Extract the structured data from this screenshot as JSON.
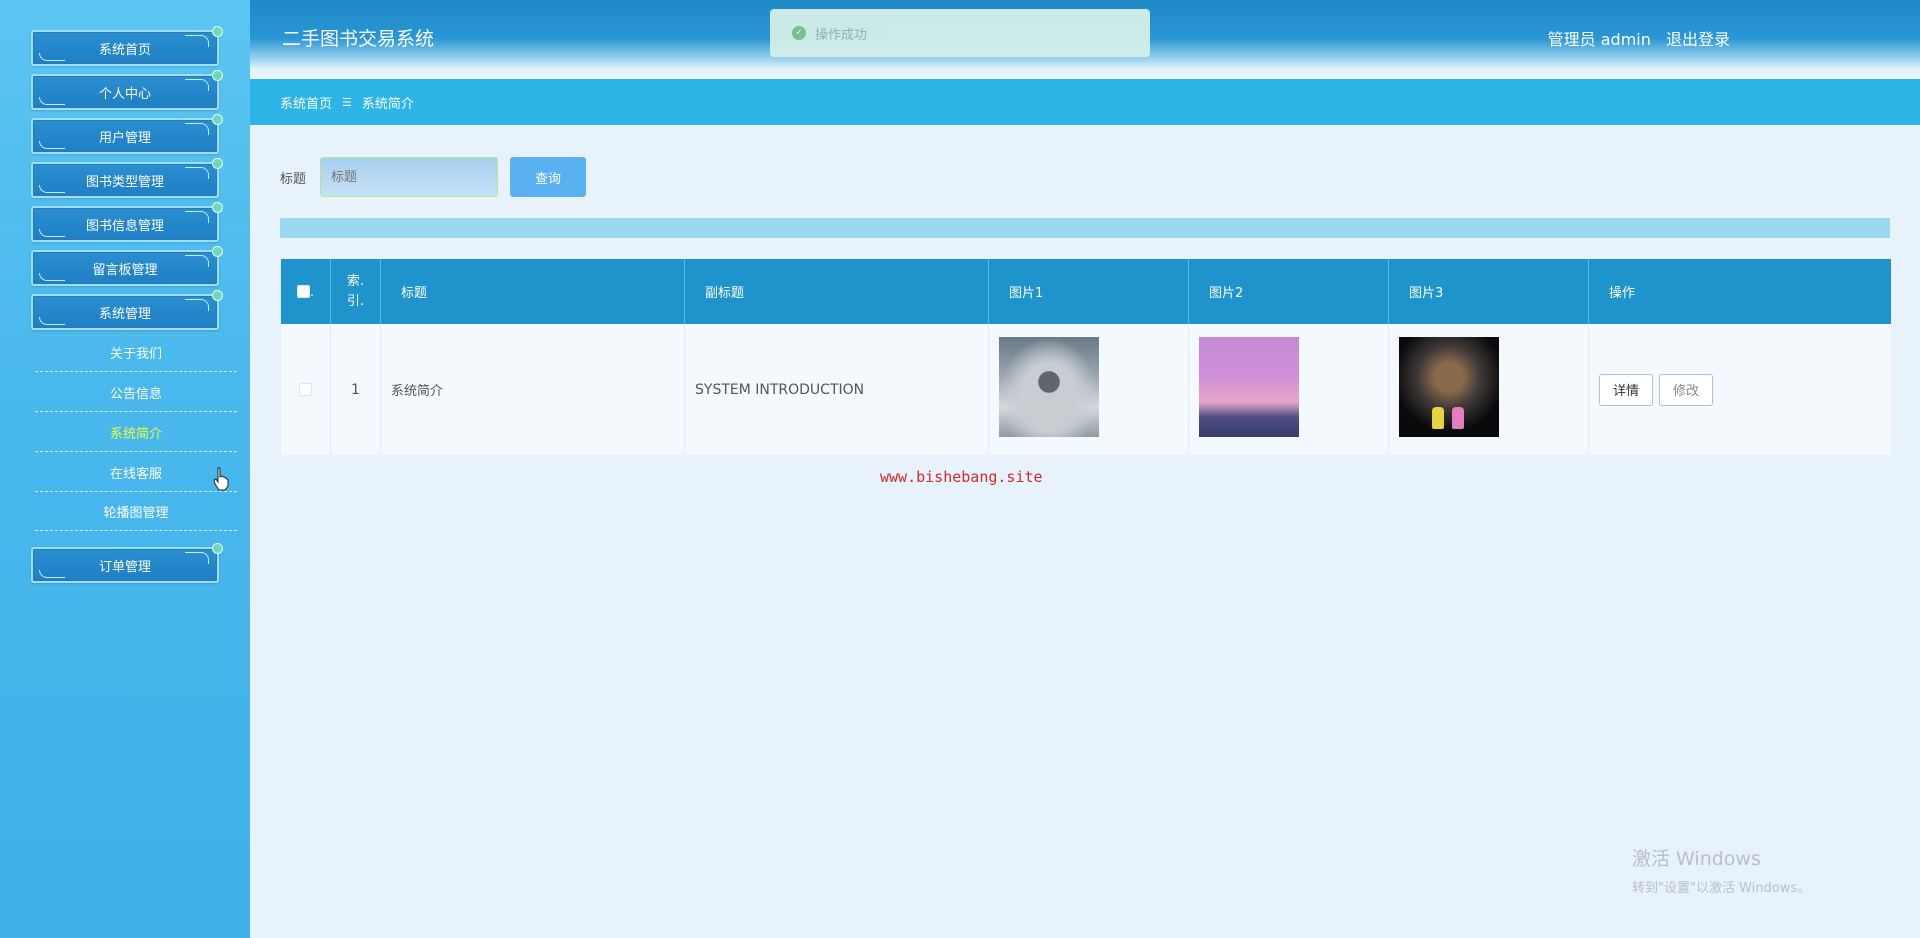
{
  "sidebar": {
    "menu": [
      {
        "label": "系统首页"
      },
      {
        "label": "个人中心"
      },
      {
        "label": "用户管理"
      },
      {
        "label": "图书类型管理"
      },
      {
        "label": "图书信息管理"
      },
      {
        "label": "留言板管理"
      },
      {
        "label": "系统管理"
      }
    ],
    "sub_items": [
      {
        "label": "关于我们"
      },
      {
        "label": "公告信息"
      },
      {
        "label": "系统简介"
      },
      {
        "label": "在线客服"
      },
      {
        "label": "轮播图管理"
      }
    ],
    "last_menu": {
      "label": "订单管理"
    }
  },
  "header": {
    "title": "二手图书交易系统",
    "toast": "操作成功",
    "user": "管理员 admin",
    "logout": "退出登录"
  },
  "breadcrumb": {
    "home": "系统首页",
    "separator": "☰",
    "current": "系统简介"
  },
  "search": {
    "label": "标题",
    "placeholder": "标题",
    "button": "查询"
  },
  "table": {
    "headers": [
      "索.\n引.",
      "标题",
      "副标题",
      "图片1",
      "图片2",
      "图片3",
      "操作"
    ],
    "rows": [
      {
        "index": "1",
        "title": "系统简介",
        "subtitle": "SYSTEM INTRODUCTION",
        "detail_btn": "详情",
        "edit_btn": "修改"
      }
    ]
  },
  "watermark": "www.bishebang.site",
  "windows_notice": {
    "line1": "激活 Windows",
    "line2": "转到\"设置\"以激活 Windows。"
  },
  "colors": {
    "sidebar": "#49b8ec",
    "header": "#1f88c6",
    "table_header": "#1e93cc",
    "accent_active": "#e6ff3a"
  }
}
